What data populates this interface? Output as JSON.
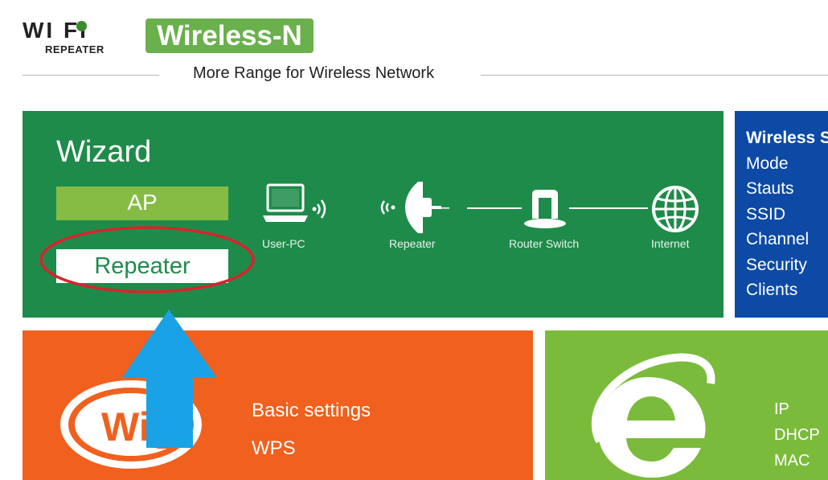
{
  "header": {
    "logo_main": "WI  FI",
    "logo_sub": "REPEATER",
    "brand": "Wireless-N",
    "tagline": "More Range for Wireless Network"
  },
  "wizard": {
    "title": "Wizard",
    "modes": {
      "ap": "AP",
      "repeater": "Repeater"
    },
    "diagram": {
      "user_pc": "User-PC",
      "repeater": "Repeater",
      "router_switch": "Router Switch",
      "internet": "Internet"
    }
  },
  "status": {
    "header": "Wireless S",
    "items": [
      "Mode",
      "Stauts",
      "SSID",
      "Channel",
      "Security",
      "Clients"
    ]
  },
  "basic": {
    "icon_text": "Wi",
    "items": [
      "Basic settings",
      "WPS"
    ]
  },
  "network": {
    "items": [
      "IP",
      "DHCP",
      "MAC"
    ]
  },
  "colors": {
    "wizard_tile": "#1f8b4a",
    "status_tile": "#0c4aa6",
    "basic_tile": "#f0601e",
    "network_tile": "#7bbb3c",
    "annotation_ellipse": "#d9232b",
    "annotation_arrow": "#1aa2e6"
  },
  "icons": [
    "laptop-wifi-icon",
    "repeater-icon",
    "router-switch-icon",
    "globe-icon",
    "wifi-logo-icon",
    "internet-explorer-icon"
  ]
}
